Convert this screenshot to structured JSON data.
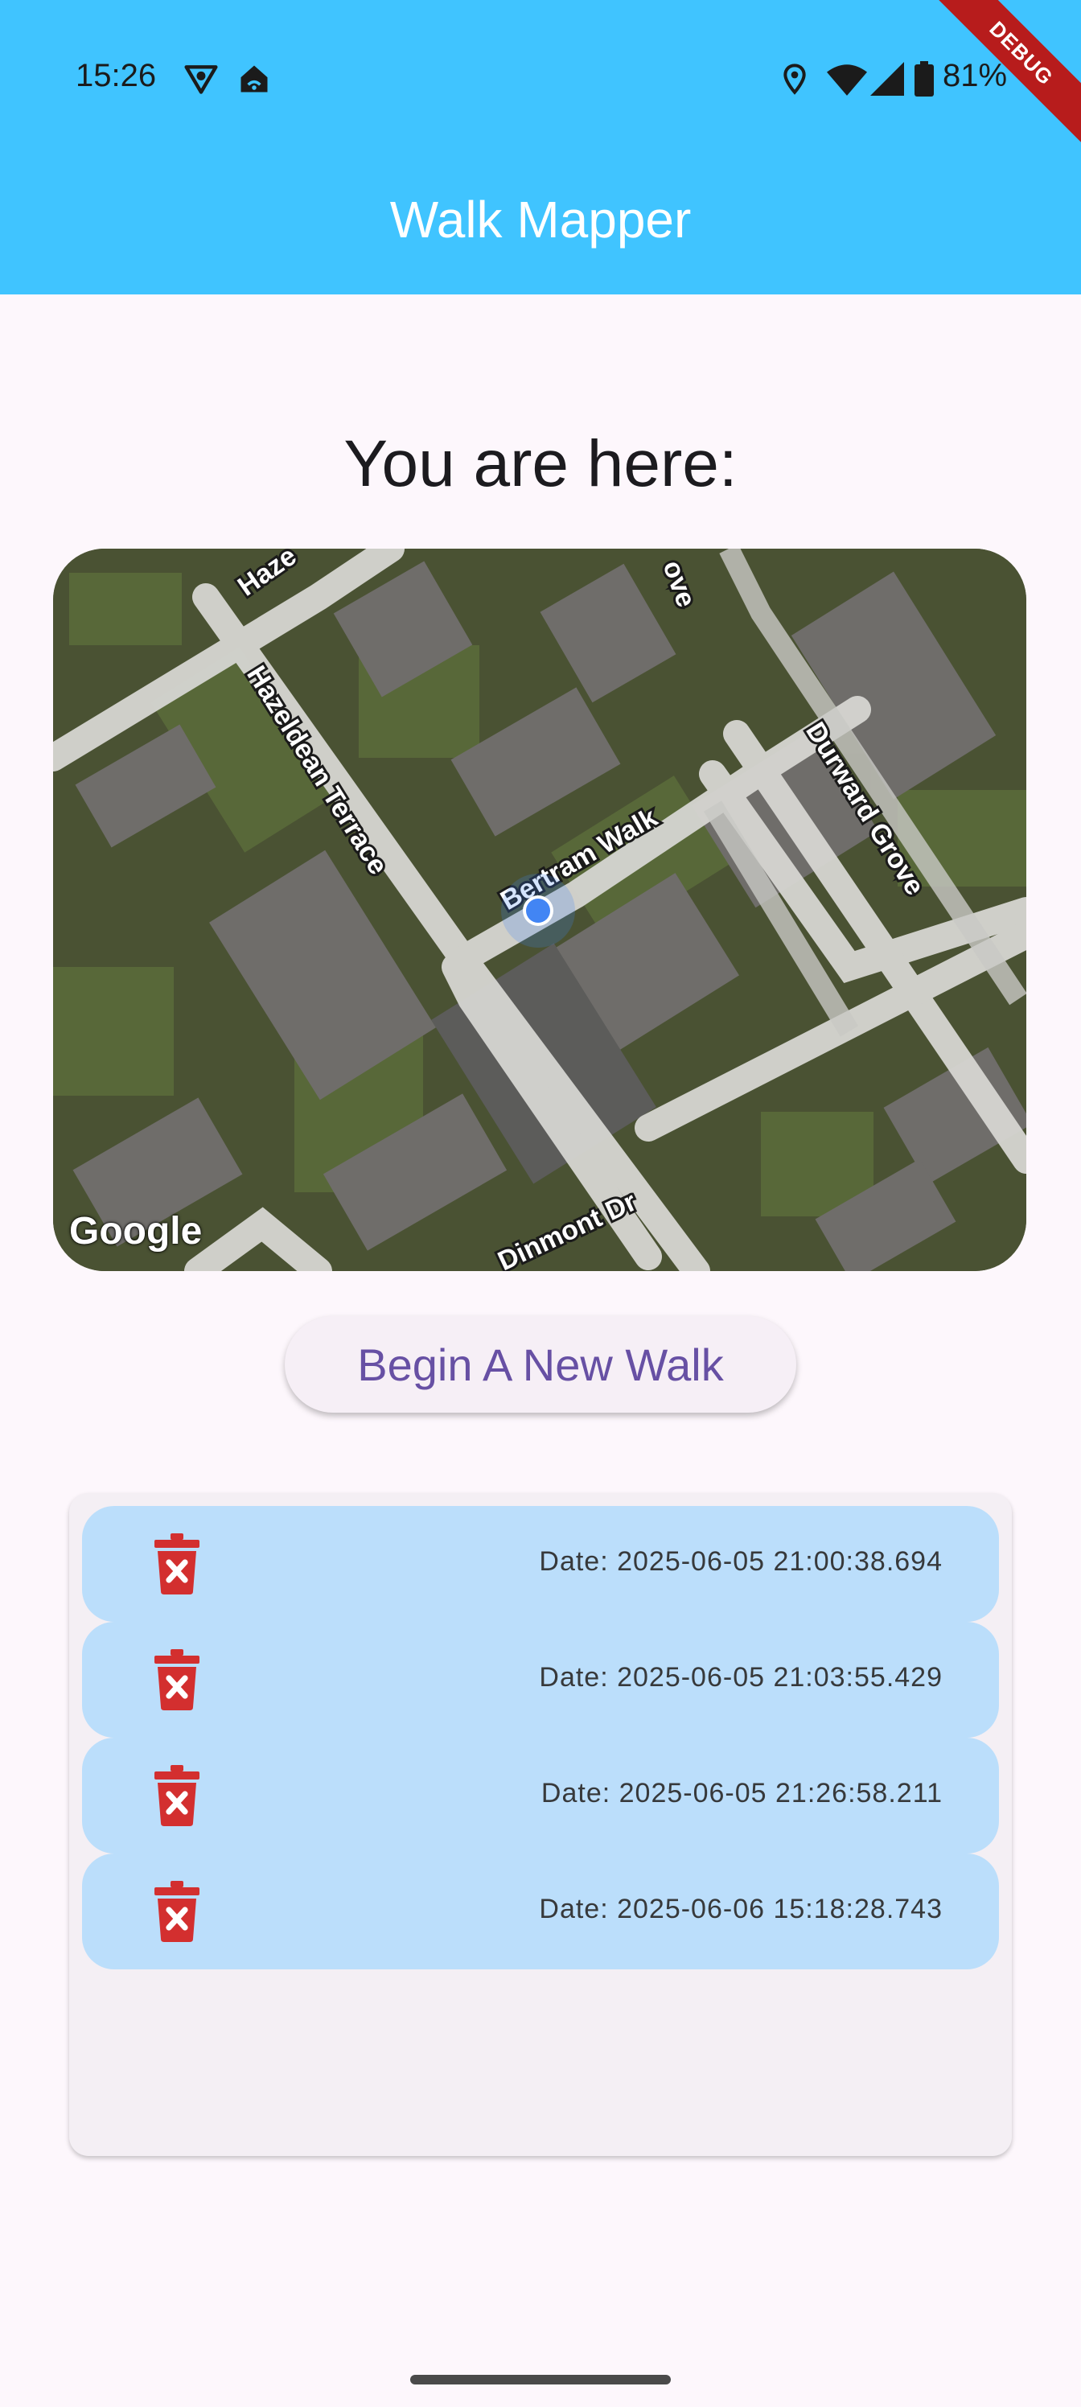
{
  "status": {
    "time": "15:26",
    "battery": "81%",
    "icons": [
      "vpn-icon",
      "home-wifi-icon",
      "location-icon",
      "wifi-icon",
      "signal-icon",
      "battery-icon"
    ]
  },
  "debug_banner": "DEBUG",
  "app": {
    "title": "Walk Mapper"
  },
  "main": {
    "heading": "You are here:",
    "map": {
      "streets": [
        "Hazeldean Terrace",
        "Bertram Walk",
        "Durward Grove",
        "Dinmont Dr",
        "Haze",
        "ove"
      ],
      "attribution": "Google"
    },
    "new_walk_button": "Begin A New Walk"
  },
  "walks": [
    {
      "date": "Date: 2025-06-05 21:00:38.694",
      "icon": "trash-icon"
    },
    {
      "date": "Date: 2025-06-05 21:03:55.429",
      "icon": "trash-icon"
    },
    {
      "date": "Date: 2025-06-05 21:26:58.211",
      "icon": "trash-icon"
    },
    {
      "date": "Date: 2025-06-06 15:18:28.743",
      "icon": "trash-icon"
    }
  ],
  "colors": {
    "app_bar": "#40c4ff",
    "background": "#fdf7fc",
    "row": "#bbdefb",
    "trash": "#d32f2f",
    "button_text": "#6750a4",
    "location_dot": "#4285f4"
  }
}
